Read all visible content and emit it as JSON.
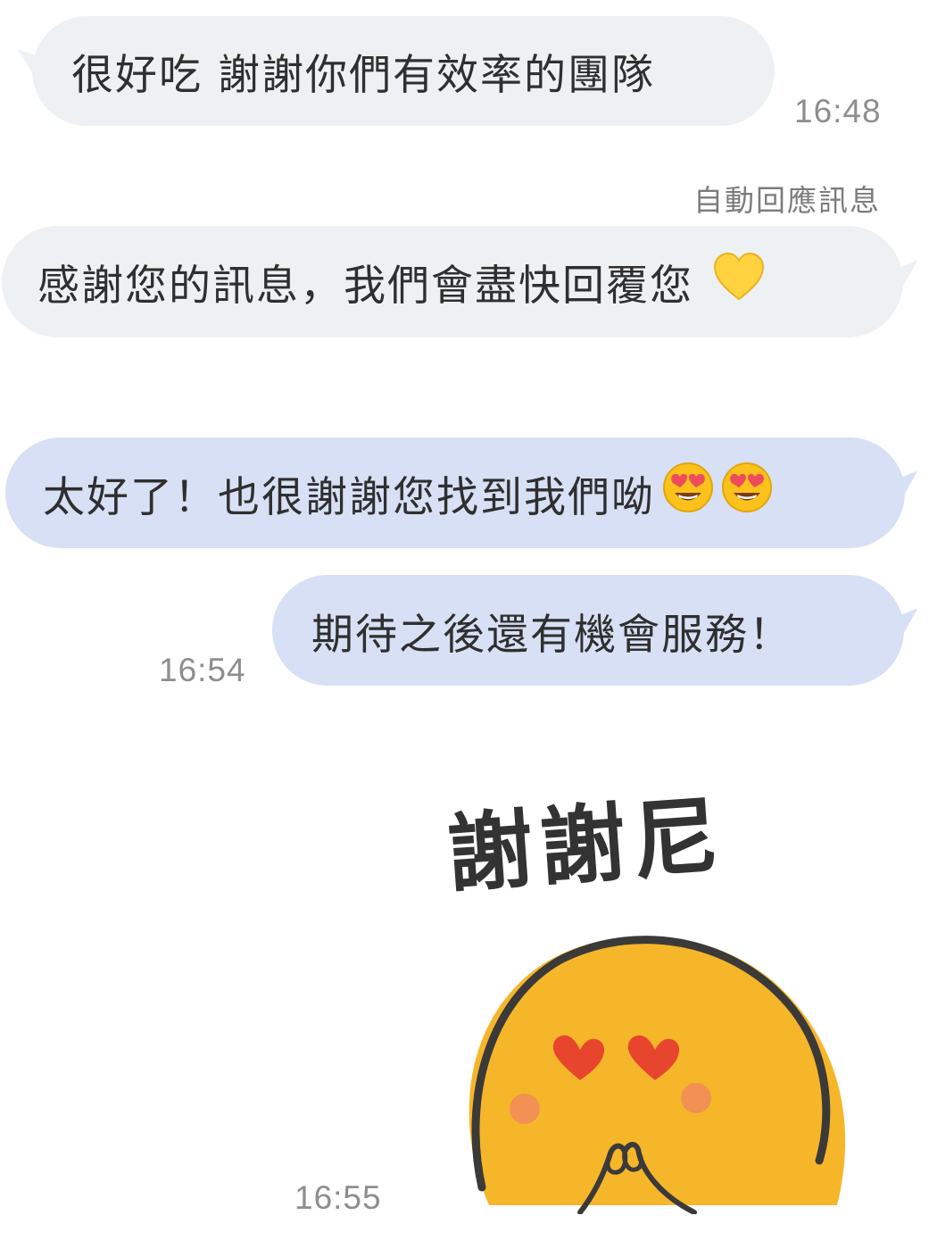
{
  "messages": [
    {
      "id": "m1",
      "direction": "incoming",
      "text": "很好吃 謝謝你們有效率的團隊",
      "time": "16:48"
    },
    {
      "id": "m2",
      "direction": "incoming",
      "label": "自動回應訊息",
      "text": "感謝您的訊息，我們會盡快回覆您",
      "emoji": "yellow-heart"
    },
    {
      "id": "m3",
      "direction": "outgoing",
      "text": "太好了！也很謝謝您找到我們呦",
      "emoji": "heart-eyes-face"
    },
    {
      "id": "m4",
      "direction": "outgoing",
      "text": "期待之後還有機會服務！",
      "time": "16:54"
    },
    {
      "id": "m5",
      "direction": "outgoing",
      "type": "sticker",
      "sticker_text": "謝謝尼",
      "sticker_icon": "blushing-yellow-blob-with-heart-eyes",
      "time": "16:55"
    }
  ],
  "colors": {
    "incoming_bubble": "#eef1f3",
    "outgoing_bubble": "#d8e0f5",
    "timestamp": "#8e8e8e"
  }
}
